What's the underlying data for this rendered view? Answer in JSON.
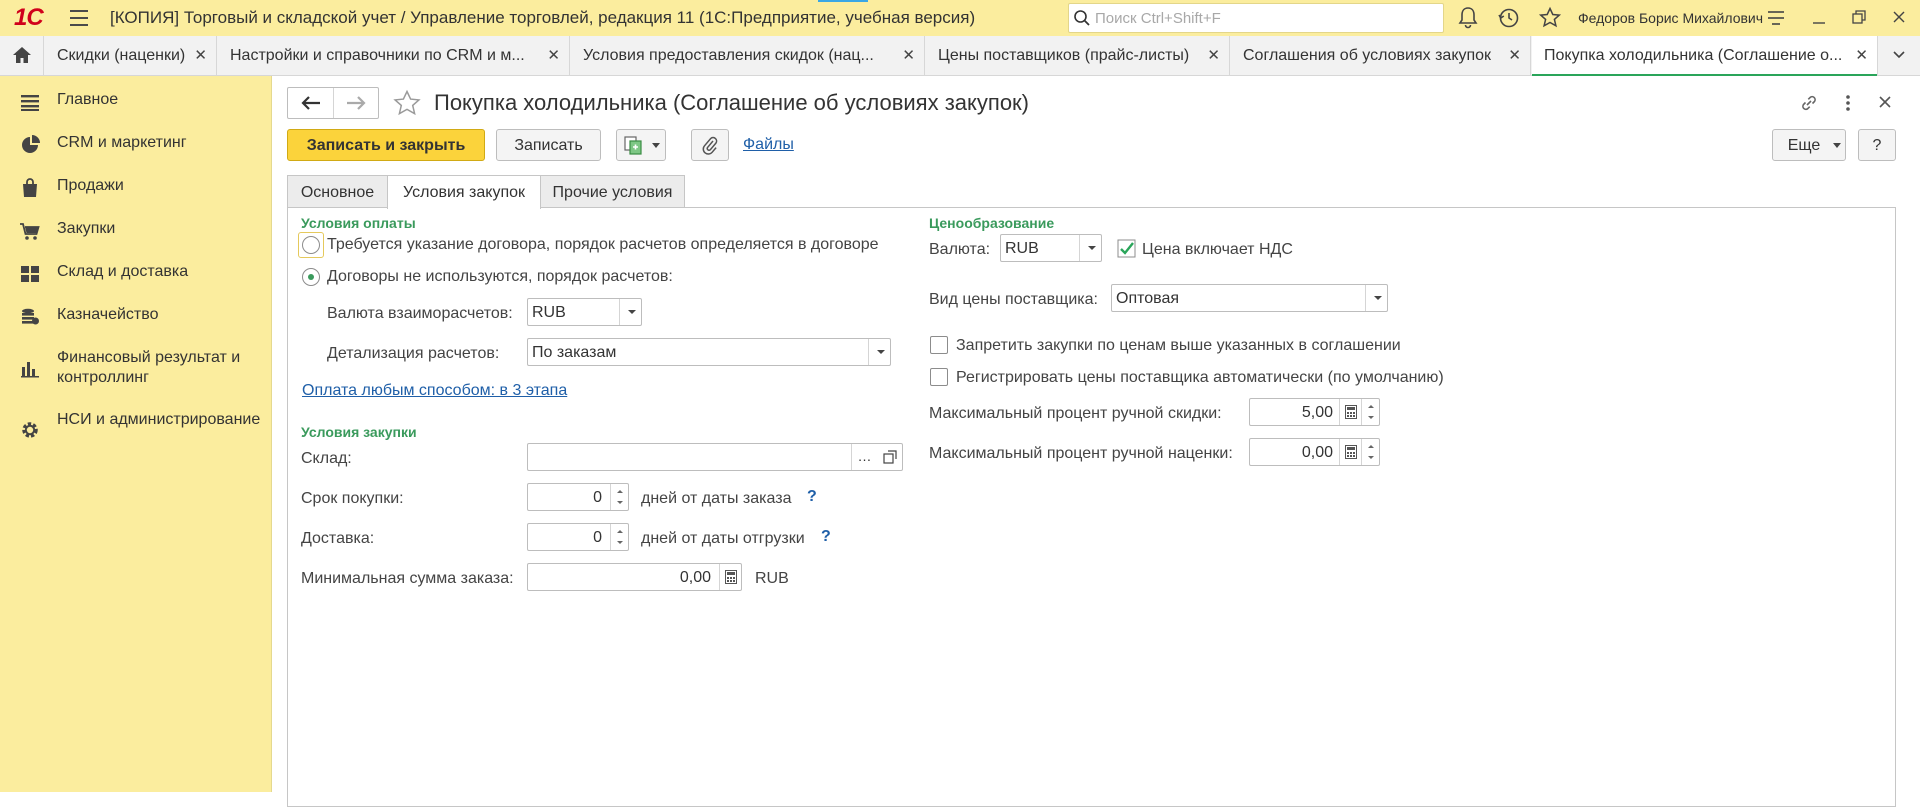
{
  "titlebar": {
    "logo": "1С",
    "app_title": "[КОПИЯ] Торговый и складской учет / Управление торговлей, редакция 11  (1С:Предприятие, учебная версия)",
    "search_placeholder": "Поиск Ctrl+Shift+F",
    "user": "Федоров Борис Михайлович"
  },
  "tabs": [
    {
      "label": "Скидки (наценки)"
    },
    {
      "label": "Настройки и справочники по CRM и м..."
    },
    {
      "label": "Условия предоставления скидок (нац..."
    },
    {
      "label": "Цены поставщиков (прайс-листы)"
    },
    {
      "label": "Соглашения об условиях закупок"
    },
    {
      "label": "Покупка холодильника (Соглашение о..."
    }
  ],
  "sidebar": {
    "items": [
      {
        "label": "Главное",
        "icon": "list-icon"
      },
      {
        "label": "CRM и маркетинг",
        "icon": "pie-chart-icon"
      },
      {
        "label": "Продажи",
        "icon": "bag-icon"
      },
      {
        "label": "Закупки",
        "icon": "cart-icon"
      },
      {
        "label": "Склад и доставка",
        "icon": "warehouse-icon"
      },
      {
        "label": "Казначейство",
        "icon": "coins-icon"
      },
      {
        "label": "Финансовый результат и контроллинг",
        "icon": "bar-chart-icon"
      },
      {
        "label": "НСИ и администрирование",
        "icon": "gear-icon"
      }
    ]
  },
  "form": {
    "title": "Покупка холодильника (Соглашение об условиях закупок)",
    "buttons": {
      "save_close": "Записать и закрыть",
      "save": "Записать",
      "files": "Файлы",
      "more": "Еще",
      "help": "?"
    },
    "tabs": [
      "Основное",
      "Условия закупок",
      "Прочие условия"
    ],
    "payment": {
      "section": "Условия оплаты",
      "option_contract": "Требуется указание договора, порядок расчетов определяется в договоре",
      "option_no_contract": "Договоры не используются, порядок расчетов:",
      "currency_label": "Валюта взаиморасчетов:",
      "currency_value": "RUB",
      "detail_label": "Детализация расчетов:",
      "detail_value": "По заказам",
      "payment_link": "Оплата любым способом: в 3 этапа"
    },
    "purchase": {
      "section": "Условия закупки",
      "warehouse_label": "Склад:",
      "warehouse_value": "",
      "term_label": "Срок покупки:",
      "term_value": "0",
      "term_suffix": "дней от даты заказа",
      "delivery_label": "Доставка:",
      "delivery_value": "0",
      "delivery_suffix": "дней от даты отгрузки",
      "min_sum_label": "Минимальная сумма заказа:",
      "min_sum_value": "0,00",
      "min_sum_currency": "RUB",
      "help_mark": "?"
    },
    "pricing": {
      "section": "Ценообразование",
      "currency_label": "Валюта:",
      "currency_value": "RUB",
      "vat_label": "Цена включает НДС",
      "vat_checked": true,
      "price_type_label": "Вид цены поставщика:",
      "price_type_value": "Оптовая",
      "forbid_label": "Запретить закупки по ценам выше указанных в соглашении",
      "forbid_checked": false,
      "register_label": "Регистрировать цены поставщика автоматически (по умолчанию)",
      "register_checked": false,
      "max_discount_label": "Максимальный процент ручной скидки:",
      "max_discount_value": "5,00",
      "max_markup_label": "Максимальный процент ручной наценки:",
      "max_markup_value": "0,00"
    }
  },
  "colors": {
    "accent_yellow": "#fbed9e",
    "primary_button": "#fbd33b",
    "section_green": "#3a9a5c",
    "link_blue": "#1f5fa8"
  }
}
